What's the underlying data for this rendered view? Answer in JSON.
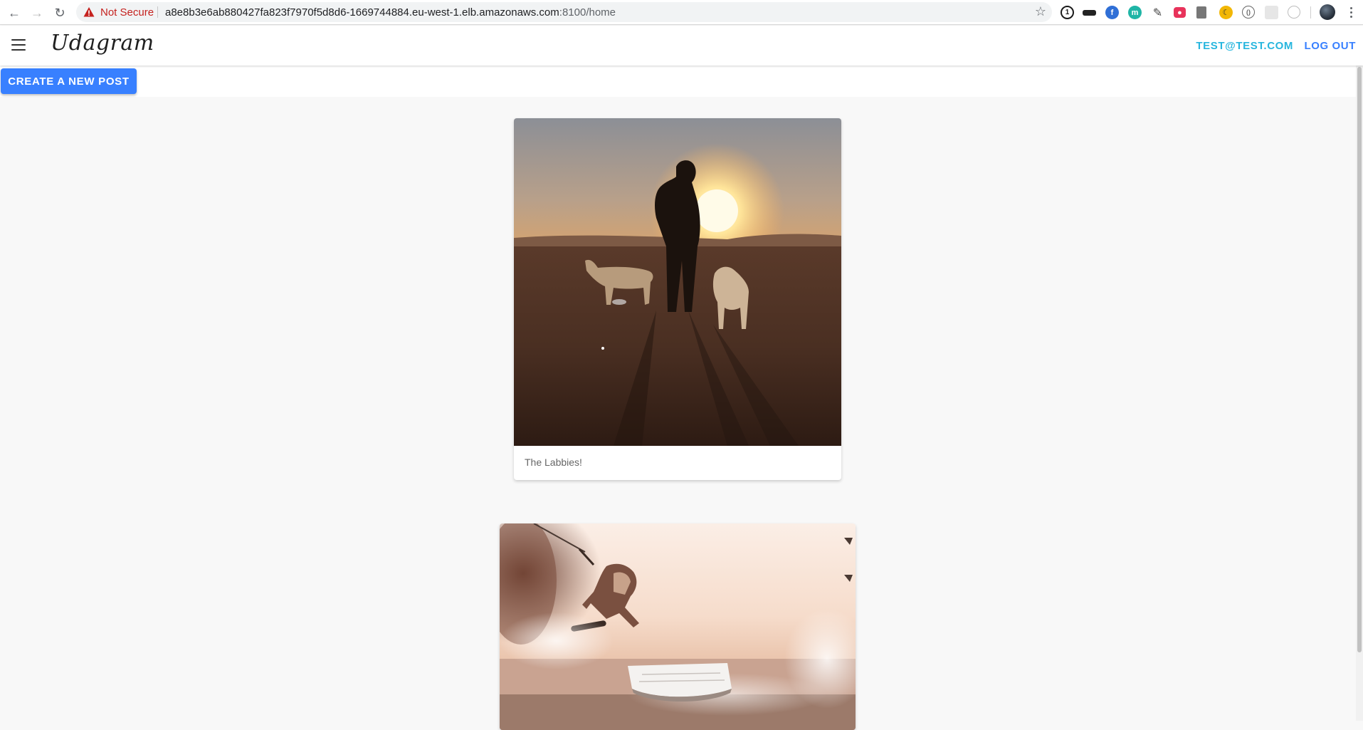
{
  "browser": {
    "security_label": "Not Secure",
    "url_host": "a8e8b3e6ab880427fa823f7970f5d8d6-1669744884.eu-west-1.elb.amazonaws.com",
    "url_rest": ":8100/home",
    "extensions": [
      {
        "icon": "1password-icon",
        "color": "#1a1a1a"
      },
      {
        "icon": "mask-icon",
        "color": "#222222"
      },
      {
        "icon": "script-icon",
        "color": "#2f6fd6"
      },
      {
        "icon": "m-icon",
        "color": "#1fb5a6"
      },
      {
        "icon": "eyedropper-icon",
        "color": "#444444"
      },
      {
        "icon": "camera-icon",
        "color": "#e8335b"
      },
      {
        "icon": "barcode-icon",
        "color": "#555555"
      },
      {
        "icon": "moon-icon",
        "color": "#f2b705"
      },
      {
        "icon": "code-icon",
        "color": "#666666"
      },
      {
        "icon": "blank-extension-icon",
        "color": "#d0d0d0"
      },
      {
        "icon": "timer-icon",
        "color": "#bdbdbd"
      }
    ]
  },
  "app": {
    "brand": "Udagram",
    "user_email": "TEST@TEST.COM",
    "logout_label": "LOG OUT",
    "create_post_label": "CREATE A NEW POST",
    "accent_color": "#3880ff",
    "secondary_color": "#27b6de"
  },
  "posts": [
    {
      "caption": "The Labbies!"
    },
    {
      "caption": ""
    }
  ]
}
